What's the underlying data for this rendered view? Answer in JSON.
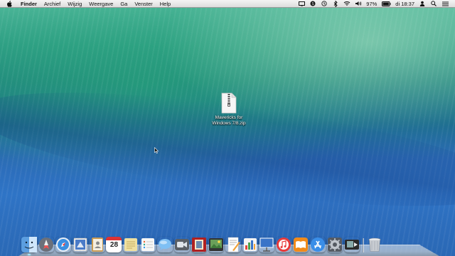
{
  "menubar": {
    "app_name": "Finder",
    "items": [
      "Archief",
      "Wijzig",
      "Weergave",
      "Ga",
      "Venster",
      "Help"
    ],
    "status": {
      "battery_percent": "97%",
      "clock": "di 18:37"
    },
    "status_icons": [
      "display-icon",
      "skype-icon",
      "time-machine-icon",
      "bluetooth-icon",
      "wifi-icon",
      "volume-icon",
      "battery-icon",
      "user-icon",
      "spotlight-icon",
      "list-icon"
    ]
  },
  "desktop": {
    "file": {
      "name_line1": "Mavericks for",
      "name_line2": "Windows 7/8.zip",
      "icon": "zip-archive-icon"
    }
  },
  "dock": {
    "apps": [
      {
        "name": "finder-icon",
        "color": "#5b9ee0",
        "running": true
      },
      {
        "name": "launchpad-icon",
        "color": "#7a7f8a",
        "running": false
      },
      {
        "name": "safari-icon",
        "color": "#3b8fe0",
        "running": false
      },
      {
        "name": "mail-stamp-icon",
        "color": "#4a7bc8",
        "running": false
      },
      {
        "name": "contacts-icon",
        "color": "#c89a52",
        "running": false
      },
      {
        "name": "calendar-icon",
        "color": "#ffffff",
        "running": false,
        "day": "28"
      },
      {
        "name": "notes-icon",
        "color": "#e8d788",
        "running": false
      },
      {
        "name": "reminders-icon",
        "color": "#f4f4f4",
        "running": false
      },
      {
        "name": "messages-icon",
        "color": "#7fc0f4",
        "running": false
      },
      {
        "name": "facetime-icon",
        "color": "#5a5f66",
        "running": false
      },
      {
        "name": "photo-booth-icon",
        "color": "#b02020",
        "running": false
      },
      {
        "name": "iphoto-icon",
        "color": "#6aa05a",
        "running": false
      },
      {
        "name": "pages-icon",
        "color": "#f2a33b",
        "running": false
      },
      {
        "name": "numbers-icon",
        "color": "#4aa34a",
        "running": false
      },
      {
        "name": "keynote-icon",
        "color": "#3a74c8",
        "running": false
      },
      {
        "name": "itunes-icon",
        "color": "#e83a3a",
        "running": false
      },
      {
        "name": "ibooks-icon",
        "color": "#f08a1a",
        "running": false
      },
      {
        "name": "app-store-icon",
        "color": "#3a8ee8",
        "running": false
      },
      {
        "name": "system-preferences-icon",
        "color": "#9aa0a8",
        "running": false
      },
      {
        "name": "photo-slideshow-icon",
        "color": "#3a3a3a",
        "running": false
      }
    ],
    "trash": {
      "name": "trash-icon",
      "color": "#c8ccd2"
    }
  }
}
